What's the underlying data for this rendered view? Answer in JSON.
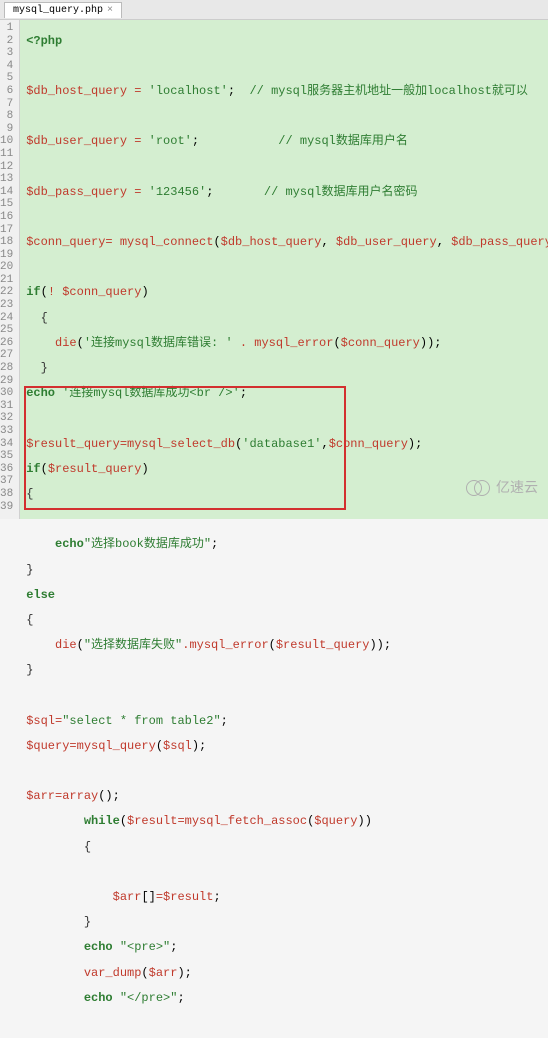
{
  "tab": {
    "name": "mysql_query.php",
    "close": "×"
  },
  "gutter": {
    "start": 1,
    "end": 39
  },
  "code": {
    "l1": "<?php",
    "l3_var": "$db_host_query",
    "l3_eq": " = ",
    "l3_str": "'localhost'",
    "l3_semi": ";",
    "l3_c": "  // mysql服务器主机地址一般加localhost就可以",
    "l5_var": "$db_user_query",
    "l5_eq": " = ",
    "l5_str": "'root'",
    "l5_semi": ";",
    "l5_c": "           // mysql数据库用户名",
    "l7_var": "$db_pass_query",
    "l7_eq": " = ",
    "l7_str": "'123456'",
    "l7_semi": ";",
    "l7_c": "       // mysql数据库用户名密码",
    "l9_var": "$conn_query",
    "l9_eq": "= ",
    "l9_fn": "mysql_connect",
    "l9_a1": "$db_host_query",
    "l9_a2": "$db_user_query",
    "l9_a3": "$db_pass_query",
    "l11_kw": "if",
    "l11_not": "! ",
    "l11_var": "$conn_query",
    "l12_brace": "{",
    "l13_fn": "die",
    "l13_str": "'连接mysql数据库错误: '",
    "l13_dot": " . ",
    "l13_fn2": "mysql_error",
    "l13_arg": "$conn_query",
    "l14_brace": "}",
    "l15_fn": "echo",
    "l15_str": " '连接mysql数据库成功<br />'",
    "l17_var": "$result_query",
    "l17_eq": "=",
    "l17_fn": "mysql_select_db",
    "l17_str": "'database1'",
    "l17_arg2": "$conn_query",
    "l18_kw": "if",
    "l18_var": "$result_query",
    "l19_brace": "{",
    "l21_fn": "echo",
    "l21_str": "\"选择book数据库成功\"",
    "l22_brace": "}",
    "l23_kw": "else",
    "l24_brace": "{",
    "l25_fn": "die",
    "l25_str": "\"选择数据库失败\"",
    "l25_dot": ".",
    "l25_fn2": "mysql_error",
    "l25_arg": "$result_query",
    "l26_brace": "}",
    "l28_var": "$sql",
    "l28_eq": "=",
    "l28_str": "\"select * from table2\"",
    "l29_var": "$query",
    "l29_eq": "=",
    "l29_fn": "mysql_query",
    "l29_arg": "$sql",
    "l31_var": "$arr",
    "l31_eq": "=",
    "l31_fn": "array",
    "l32_kw": "while",
    "l32_var": "$result",
    "l32_eq": "=",
    "l32_fn": "mysql_fetch_assoc",
    "l32_arg": "$query",
    "l33_brace": "{",
    "l35_var": "$arr",
    "l35_br": "[]",
    "l35_eq": "=",
    "l35_val": "$result",
    "l36_brace": "}",
    "l37_fn": "echo",
    "l37_str": " \"<pre>\"",
    "l38_fn": "var_dump",
    "l38_arg": "$arr",
    "l39_fn": "echo",
    "l39_str": " \"</pre>\""
  },
  "watermark": "亿速云"
}
